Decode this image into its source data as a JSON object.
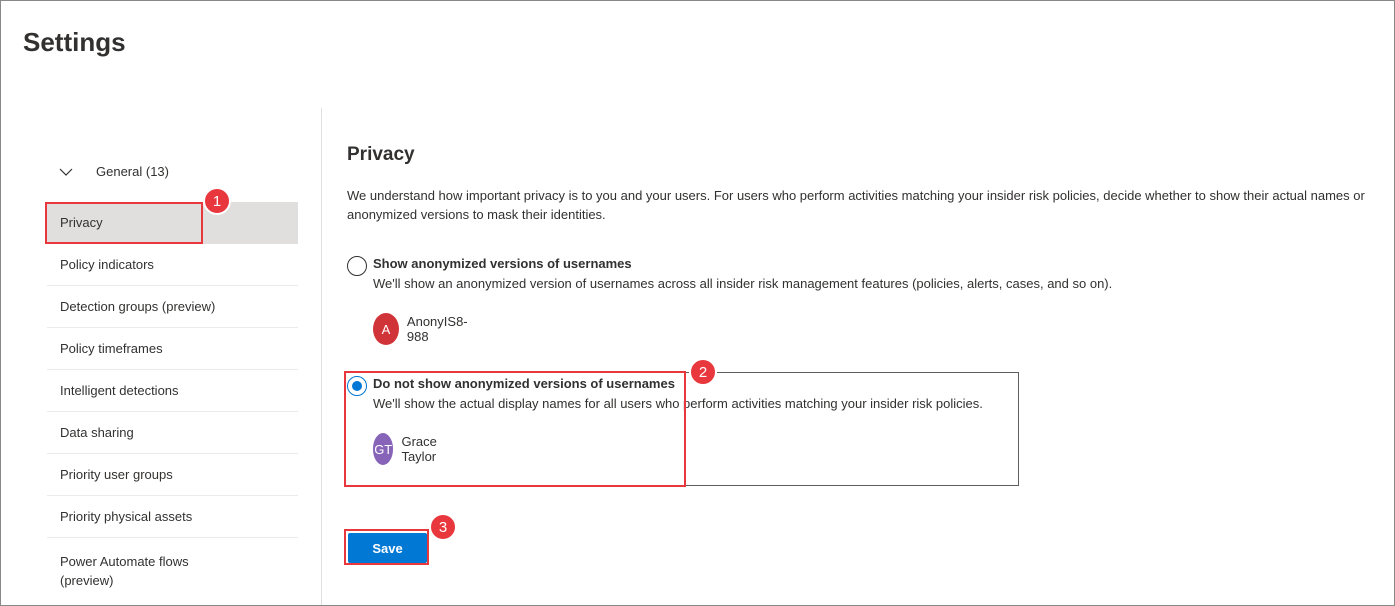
{
  "page": {
    "title": "Settings"
  },
  "sidebar": {
    "group": {
      "label": "General (13)",
      "icon": "chevron-down-icon"
    },
    "items": [
      {
        "label": "Privacy",
        "selected": true
      },
      {
        "label": "Policy indicators"
      },
      {
        "label": "Detection groups (preview)"
      },
      {
        "label": "Policy timeframes"
      },
      {
        "label": "Intelligent detections"
      },
      {
        "label": "Data sharing"
      },
      {
        "label": "Priority user groups"
      },
      {
        "label": "Priority physical assets"
      },
      {
        "label": "Power Automate flows (preview)"
      }
    ]
  },
  "main": {
    "section_title": "Privacy",
    "description": "We understand how important privacy is to you and your users. For users who perform activities matching your insider risk policies, decide whether to show their actual names or anonymized versions to mask their identities.",
    "options": [
      {
        "label": "Show anonymized versions of usernames",
        "description": "We'll show an anonymized version of usernames across all insider risk management features (policies, alerts, cases, and so on).",
        "checked": false,
        "example": {
          "initials": "A",
          "name": "AnonyIS8-988",
          "color": "#d13438"
        }
      },
      {
        "label": "Do not show anonymized versions of usernames",
        "description": "We'll show the actual display names for all users who perform activities matching your insider risk policies.",
        "checked": true,
        "example": {
          "initials": "GT",
          "name": "Grace Taylor",
          "color": "#8764b8"
        }
      }
    ],
    "save_label": "Save"
  },
  "callouts": [
    "1",
    "2",
    "3"
  ],
  "colors": {
    "accent": "#0078d4",
    "callout": "#e8383d",
    "selected_nav": "#e1dfdd"
  }
}
